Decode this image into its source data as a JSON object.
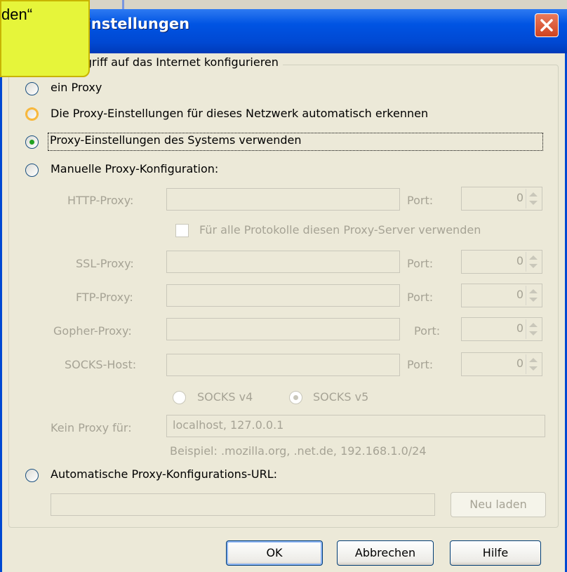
{
  "window": {
    "title": "Verbindungs-Einstellungen",
    "title_visible": "gs-Einstellungen"
  },
  "note": {
    "text": "den“"
  },
  "group": {
    "legend": "Proxy den Zugriff auf das Internet konfigurieren",
    "legend_visible": "y den Zugriff auf das Internet konfigurieren"
  },
  "options": {
    "no_proxy": "Kein Proxy",
    "no_proxy_visible": "ein Proxy",
    "auto_detect": "Die Proxy-Einstellungen für dieses Netzwerk automatisch erkennen",
    "system": "Proxy-Einstellungen des Systems verwenden",
    "manual": "Manuelle Proxy-Konfiguration:",
    "auto_url": "Automatische Proxy-Konfigurations-URL:",
    "selected": "system"
  },
  "manual": {
    "http_label": "HTTP-Proxy:",
    "all_protocols": "Für alle Protokolle diesen Proxy-Server verwenden",
    "ssl_label": "SSL-Proxy:",
    "ftp_label": "FTP-Proxy:",
    "gopher_label": "Gopher-Proxy:",
    "socks_label": "SOCKS-Host:",
    "port_label": "Port:",
    "port_value": "0",
    "socks_v4": "SOCKS v4",
    "socks_v5": "SOCKS v5",
    "no_proxy_for_label": "Kein Proxy für:",
    "no_proxy_for_value": "localhost, 127.0.0.1",
    "example": "Beispiel: .mozilla.org, .net.de, 192.168.1.0/24"
  },
  "buttons": {
    "reload": "Neu laden",
    "ok": "OK",
    "cancel": "Abbrechen",
    "help": "Hilfe"
  },
  "colors": {
    "titlebar": "#0054E3",
    "dialog_bg": "#ECE9D8",
    "note_bg": "#E6F53A",
    "radio_selected": "#21A121",
    "disabled_text": "#A6A395"
  }
}
